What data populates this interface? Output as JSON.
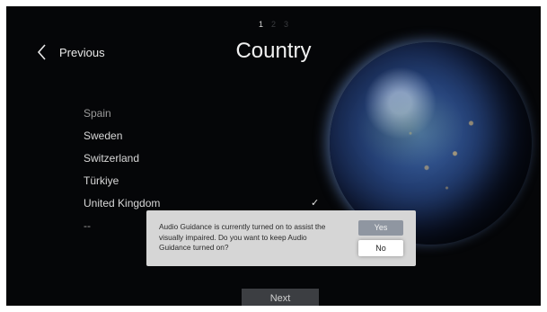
{
  "step_indicator": {
    "current": "1",
    "next1": "2",
    "next2": "3"
  },
  "nav": {
    "previous_label": "Previous"
  },
  "page_title": "Country",
  "countries": [
    {
      "label": "Spain",
      "faded": true
    },
    {
      "label": "Sweden"
    },
    {
      "label": "Switzerland"
    },
    {
      "label": "Türkiye"
    },
    {
      "label": "United Kingdom",
      "selected": true,
      "check": "✓"
    },
    {
      "label": "--",
      "faded": true
    }
  ],
  "dialog": {
    "message": "Audio Guidance is currently turned on to assist the visually impaired. Do you want to keep Audio Guidance turned on?",
    "yes_label": "Yes",
    "no_label": "No"
  },
  "footer": {
    "next_label": "Next"
  },
  "icons": {
    "back": "chevron-left-icon",
    "selected": "checkmark-icon"
  },
  "colors": {
    "background": "#050608",
    "dialog": "#d6d6d6",
    "yes_button": "#8f96a1",
    "next_button": "#3c3e42"
  }
}
